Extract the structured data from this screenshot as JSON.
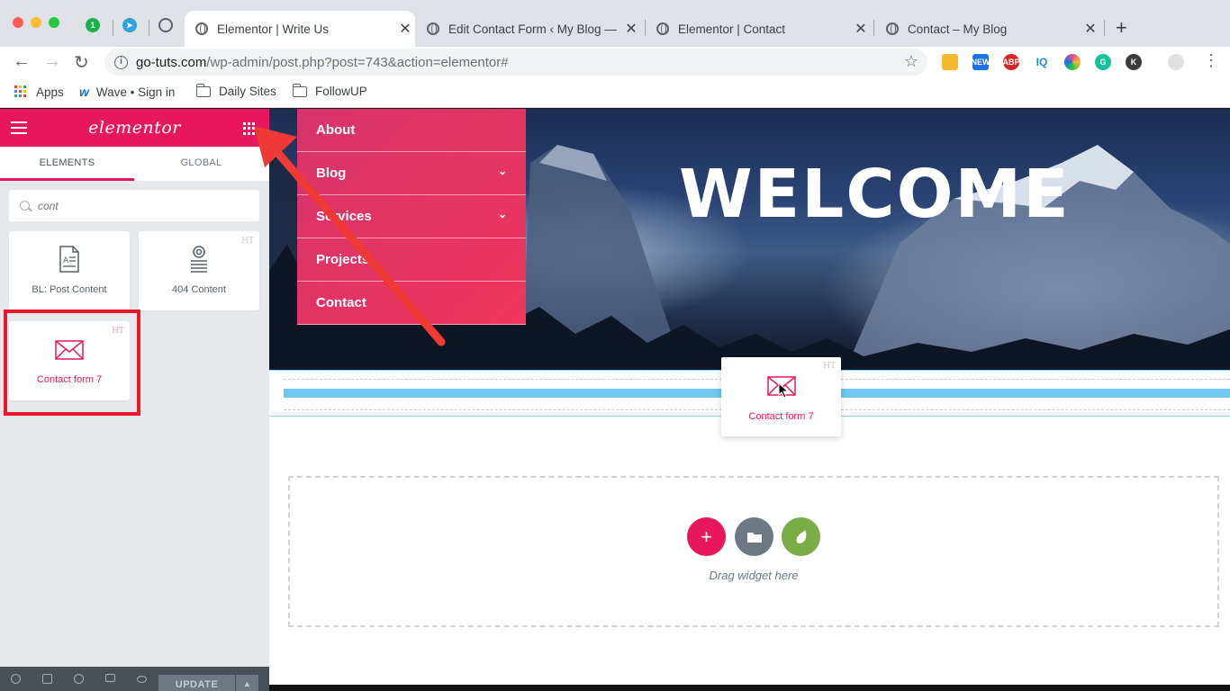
{
  "browser": {
    "tabs": [
      {
        "title": "Elementor | Write Us",
        "active": true
      },
      {
        "title": "Edit Contact Form ‹ My Blog —",
        "active": false
      },
      {
        "title": "Elementor | Contact",
        "active": false
      },
      {
        "title": "Contact – My Blog",
        "active": false
      }
    ],
    "pinned_badge": "1",
    "close_glyph": "✕",
    "new_tab_glyph": "+",
    "url_host": "go-tuts.com",
    "url_path": "/wp-admin/post.php?post=743&action=elementor#",
    "extensions": [
      {
        "label": "",
        "color": "#f6b92b"
      },
      {
        "label": "NEW",
        "color": "#1a73e8"
      },
      {
        "label": "ABP",
        "color": "#d62828"
      },
      {
        "label": "IQ",
        "color": "#ffffff",
        "text_color": "#1a8fd8"
      },
      {
        "label": "",
        "color": "#e34c8c"
      },
      {
        "label": "G",
        "color": "#15c39a"
      },
      {
        "label": "K",
        "color": "#3b3b3b"
      }
    ],
    "bookmarks": [
      {
        "label": "Apps",
        "icon": "apps-grid-icon"
      },
      {
        "label": "Wave • Sign in",
        "icon": "wave-icon"
      },
      {
        "label": "Daily Sites",
        "icon": "folder-icon"
      },
      {
        "label": "FollowUP",
        "icon": "folder-icon"
      }
    ]
  },
  "panel": {
    "logo": "elementor",
    "accent": "#e8175d",
    "tabs": {
      "elements": "ELEMENTS",
      "global": "GLOBAL"
    },
    "search": {
      "value": "",
      "placeholder": "cont"
    },
    "widgets": [
      {
        "label": "BL: Post Content",
        "icon": "document-icon",
        "badge": ""
      },
      {
        "label": "404 Content",
        "icon": "settings-list-icon",
        "badge": "HT"
      },
      {
        "label": "Contact form 7",
        "icon": "envelope-icon",
        "badge": "HT",
        "highlighted": true
      }
    ],
    "footer": {
      "update": "UPDATE",
      "caret": "▲"
    }
  },
  "preview": {
    "hero_title": "WELCOME",
    "menu": [
      {
        "label": "About",
        "has_submenu": false
      },
      {
        "label": "Blog",
        "has_submenu": true
      },
      {
        "label": "Services",
        "has_submenu": true
      },
      {
        "label": "Projects",
        "has_submenu": false
      },
      {
        "label": "Contact",
        "has_submenu": false
      }
    ],
    "dragging_widget": {
      "label": "Contact form 7",
      "badge": "HT"
    },
    "add_section": {
      "drag_text": "Drag widget here",
      "add_glyph": "+"
    }
  }
}
